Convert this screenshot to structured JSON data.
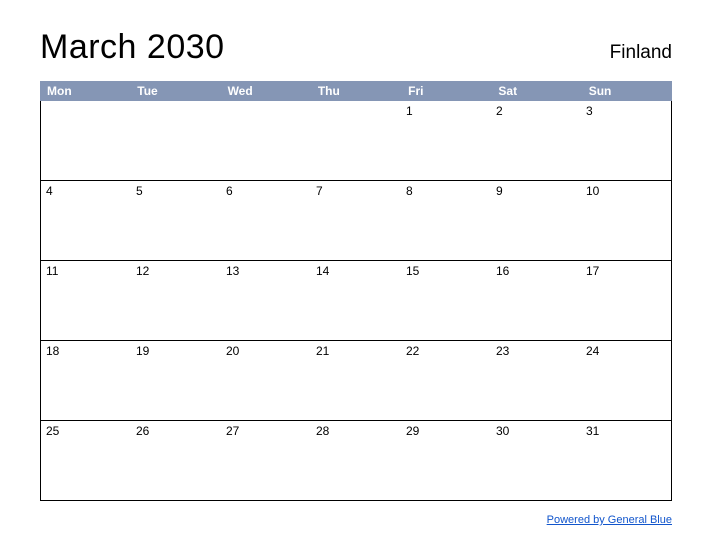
{
  "header": {
    "title": "March 2030",
    "region": "Finland"
  },
  "days": [
    "Mon",
    "Tue",
    "Wed",
    "Thu",
    "Fri",
    "Sat",
    "Sun"
  ],
  "weeks": [
    [
      "",
      "",
      "",
      "",
      "1",
      "2",
      "3"
    ],
    [
      "4",
      "5",
      "6",
      "7",
      "8",
      "9",
      "10"
    ],
    [
      "11",
      "12",
      "13",
      "14",
      "15",
      "16",
      "17"
    ],
    [
      "18",
      "19",
      "20",
      "21",
      "22",
      "23",
      "24"
    ],
    [
      "25",
      "26",
      "27",
      "28",
      "29",
      "30",
      "31"
    ]
  ],
  "footer": {
    "link_text": "Powered by General Blue"
  }
}
